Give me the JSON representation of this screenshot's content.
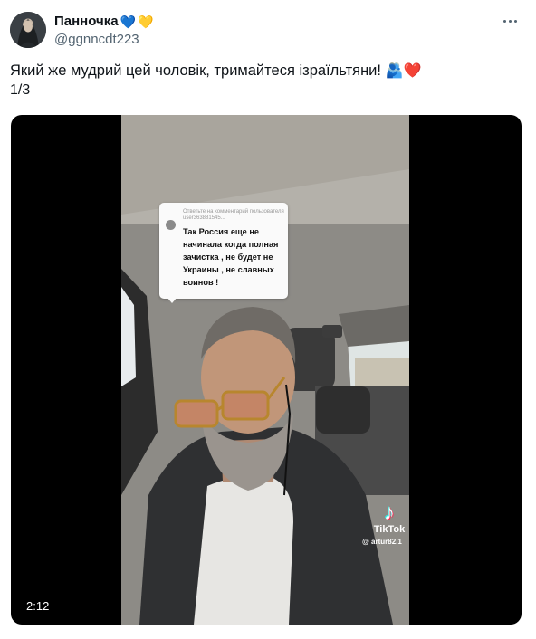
{
  "tweet": {
    "display_name": "Панночка",
    "name_emojis": [
      "💙",
      "💛"
    ],
    "handle": "@ggnncdt223",
    "text": "Який же мудрий цей чоловік, тримайтеся ізраїльтяни!",
    "text_emojis": [
      "🫂",
      "❤️"
    ],
    "thread_counter": "1/3"
  },
  "media": {
    "duration": "2:12",
    "comment": {
      "reply_to": "Ответьте на комментарий пользователя user363881545...",
      "text": "Так Россия еще не начинала когда полная зачистка , не будет не Украины , не славных воинов !"
    },
    "watermark": {
      "brand": "TikTok",
      "user": "@ artur82.1"
    }
  },
  "colors": {
    "text_primary": "#0f1419",
    "text_secondary": "#536471",
    "media_bg": "#000000",
    "heart_blue": "#5aa9e6",
    "heart_yellow": "#f5c518",
    "heart_red": "#e0245e"
  },
  "icons": {
    "more": "more-dots-icon",
    "tiktok": "tiktok-note-icon"
  }
}
